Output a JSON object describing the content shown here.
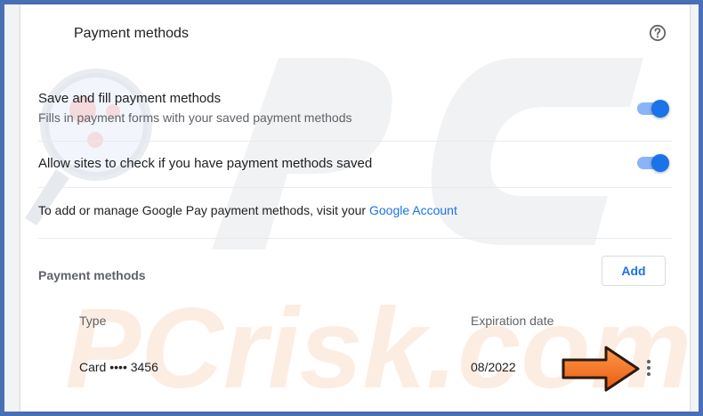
{
  "header": {
    "title": "Payment methods",
    "help_icon": "help-circle-icon"
  },
  "settings": [
    {
      "title": "Save and fill payment methods",
      "subtitle": "Fills in payment forms with your saved payment methods",
      "enabled": true
    },
    {
      "title": "Allow sites to check if you have payment methods saved",
      "enabled": true
    }
  ],
  "gpay": {
    "text": "To add or manage Google Pay payment methods, visit your ",
    "link": "Google Account"
  },
  "methods": {
    "label": "Payment methods",
    "add_label": "Add",
    "columns": {
      "type": "Type",
      "expiration": "Expiration date"
    },
    "rows": [
      {
        "type": "Card •••• 3456",
        "expiration": "08/2022",
        "menu_icon": "more-vert-icon"
      }
    ]
  },
  "watermark": {
    "text": "PCrisk.com"
  },
  "colors": {
    "accent": "#1a73e8",
    "toggle_track": "#8ab4f8",
    "arrow": "#f26a1b",
    "frame": "#4a6fb8"
  }
}
